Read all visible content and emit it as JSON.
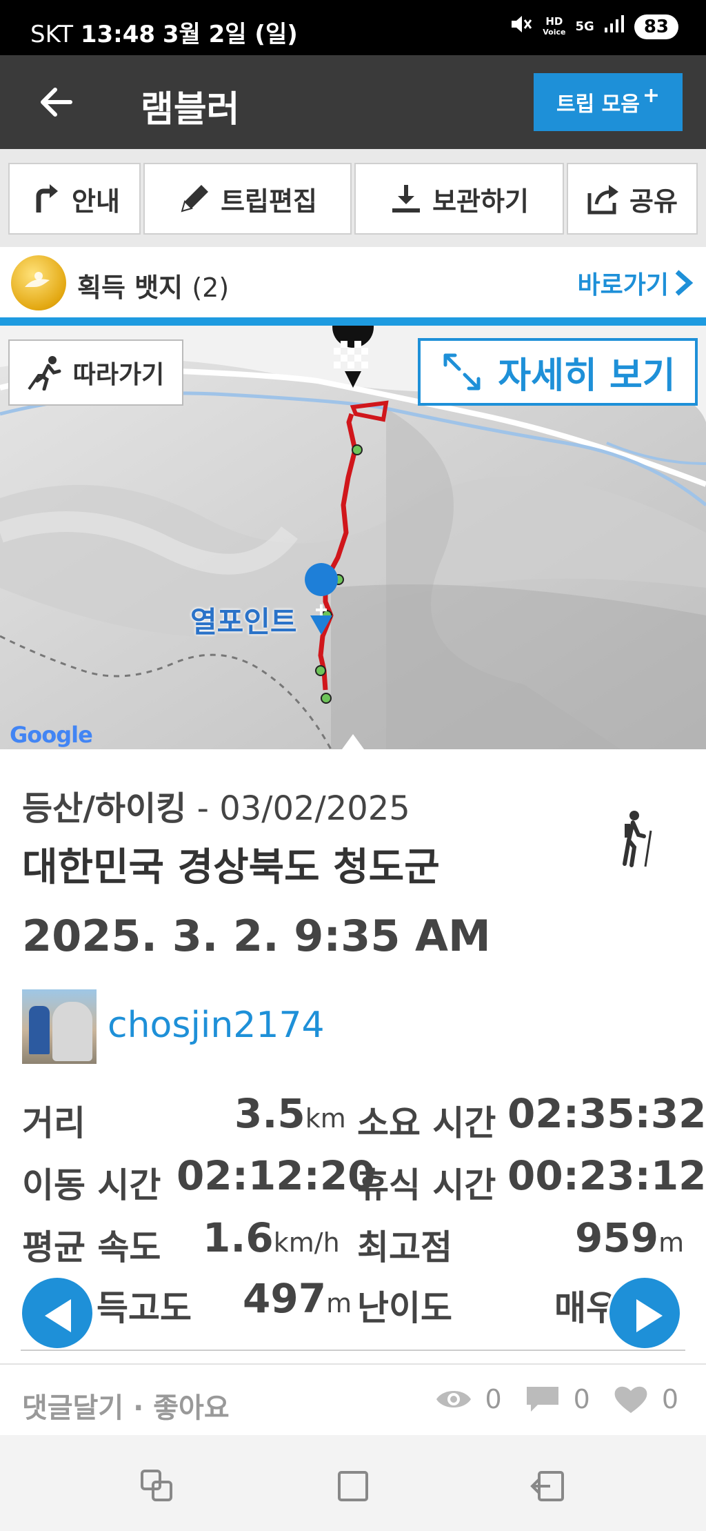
{
  "status_bar": {
    "carrier": "SKT",
    "time": "13:48",
    "date": "3월 2일 (일)",
    "battery": "83",
    "hd_label": "HD",
    "voice_label": "Voice",
    "network": "5G"
  },
  "app_bar": {
    "title": "램블러",
    "trip_collection_label": "트립 모음",
    "trip_collection_plus": "+"
  },
  "actions": {
    "guide": "안내",
    "edit_trip": "트립편집",
    "save": "보관하기",
    "share": "공유"
  },
  "badges": {
    "label": "획득 뱃지",
    "count": "(2)",
    "goto_label": "바로가기"
  },
  "map": {
    "follow_label": "따라가기",
    "detail_label": "자세히 보기",
    "poi_label": "열포인트",
    "attribution": "Google",
    "route_color": "#d0161b",
    "accent": "#1e90d8"
  },
  "trip": {
    "activity": "등산/하이킹",
    "date_sep": " - ",
    "date": "03/02/2025",
    "location": "대한민국 경상북도 청도군",
    "datetime": "2025. 3. 2. 9:35 AM",
    "username": "chosjin2174"
  },
  "stats": {
    "distance_label": "거리",
    "distance_value": "3.5",
    "distance_unit": "km",
    "duration_label": "소요 시간",
    "duration_value": "02:35:32",
    "moving_label": "이동 시간",
    "moving_value": "02:12:20",
    "rest_label": "휴식 시간",
    "rest_value": "00:23:12",
    "avg_speed_label": "평균 속도",
    "avg_speed_value": "1.6",
    "avg_speed_unit": "km/h",
    "max_alt_label": "최고점",
    "max_alt_value": "959",
    "max_alt_unit": "m",
    "gain_label": "득고도",
    "gain_value": "497",
    "gain_unit": "m",
    "difficulty_label": "난이도",
    "difficulty_value": "매우"
  },
  "bottom": {
    "comment_like": "댓글달기 · 좋아요",
    "views": "0",
    "comments": "0",
    "likes": "0"
  }
}
